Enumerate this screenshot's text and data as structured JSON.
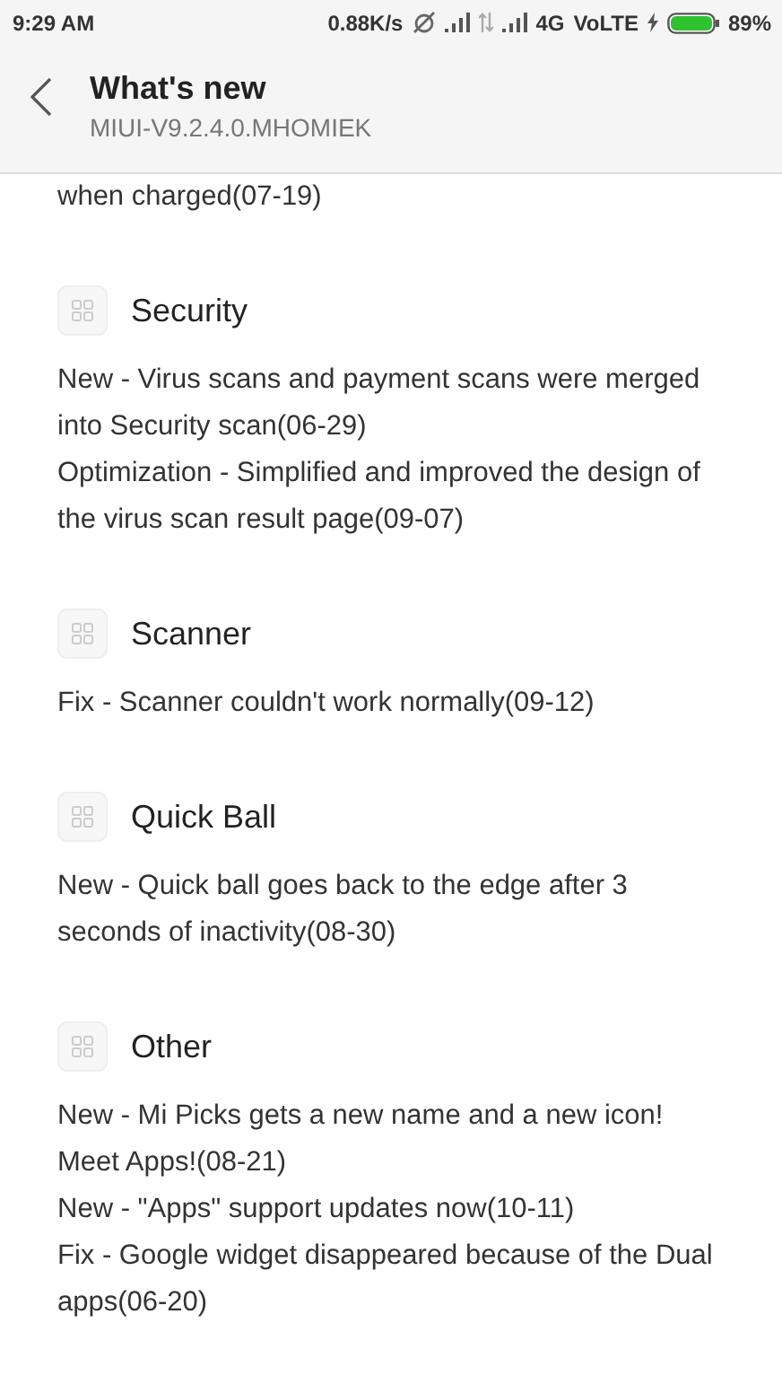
{
  "status_bar": {
    "time": "9:29 AM",
    "speed": "0.88K/s",
    "network": "4G",
    "volte": "VoLTE",
    "battery": "89%"
  },
  "header": {
    "title": "What's new",
    "subtitle": "MIUI-V9.2.4.0.MHOMIEK"
  },
  "leading_text": "when charged(07-19)",
  "sections": [
    {
      "title": "Security",
      "items": [
        "New - Virus scans and payment scans were merged into Security scan(06-29)",
        "Optimization - Simplified and improved the design of the virus scan result page(09-07)"
      ]
    },
    {
      "title": "Scanner",
      "items": [
        "Fix - Scanner couldn't work normally(09-12)"
      ]
    },
    {
      "title": "Quick Ball",
      "items": [
        "New - Quick ball goes back to the edge after 3 seconds of inactivity(08-30)"
      ]
    },
    {
      "title": "Other",
      "items": [
        "New - Mi Picks gets a new name and a new icon! Meet Apps!(08-21)",
        "New - \"Apps\" support updates now(10-11)",
        "Fix - Google widget disappeared because of the Dual apps(06-20)"
      ]
    }
  ]
}
